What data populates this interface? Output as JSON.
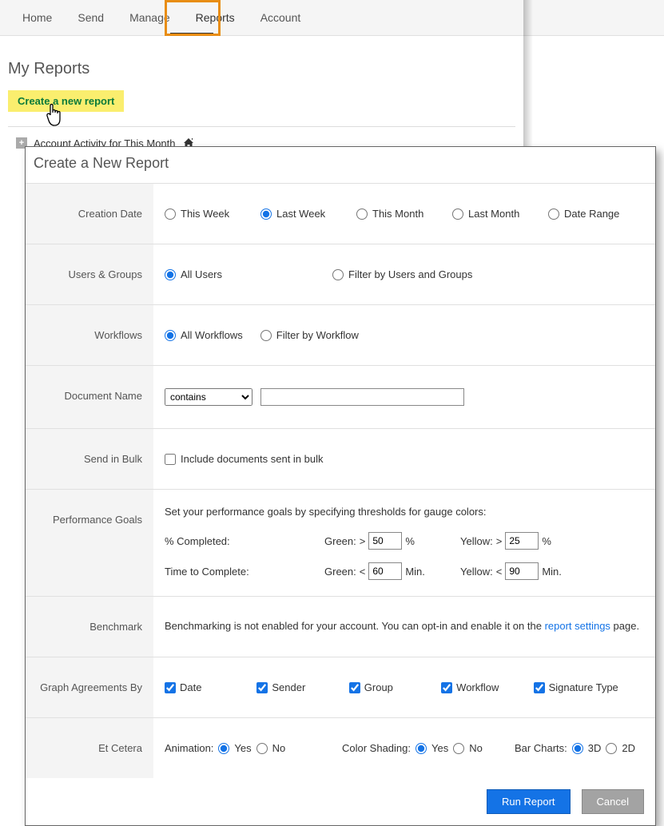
{
  "nav": {
    "home": "Home",
    "send": "Send",
    "manage": "Manage",
    "reports": "Reports",
    "account": "Account"
  },
  "my_reports": {
    "title": "My Reports",
    "create_link": "Create a new report",
    "activity_label": "Account Activity for This Month",
    "plus": "+"
  },
  "modal": {
    "title": "Create a New Report",
    "labels": {
      "creation_date": "Creation Date",
      "users_groups": "Users & Groups",
      "workflows": "Workflows",
      "document_name": "Document Name",
      "send_bulk": "Send in Bulk",
      "perf_goals": "Performance Goals",
      "benchmark": "Benchmark",
      "graph_by": "Graph Agreements By",
      "et_cetera": "Et Cetera"
    },
    "creation_date_options": {
      "this_week": "This Week",
      "last_week": "Last Week",
      "this_month": "This Month",
      "last_month": "Last Month",
      "date_range": "Date Range"
    },
    "users_groups_options": {
      "all": "All Users",
      "filter": "Filter by Users and Groups"
    },
    "workflows_options": {
      "all": "All Workflows",
      "filter": "Filter by Workflow"
    },
    "doc_name": {
      "operator": "contains",
      "value": ""
    },
    "bulk_checkbox": "Include documents sent in bulk",
    "perf": {
      "intro": "Set your performance goals by specifying thresholds for gauge colors:",
      "pct_label": "% Completed:",
      "time_label": "Time to Complete:",
      "green": "Green:",
      "yellow": "Yellow:",
      "gt": ">",
      "lt": "<",
      "pct": "%",
      "min": "Min.",
      "green_pct": "50",
      "yellow_pct": "25",
      "green_time": "60",
      "yellow_time": "90"
    },
    "benchmark_text_1": "Benchmarking is not enabled for your account. You can opt-in and enable it on the ",
    "benchmark_link": "report settings",
    "benchmark_text_2": " page.",
    "graph_by_opts": {
      "date": "Date",
      "sender": "Sender",
      "group": "Group",
      "workflow": "Workflow",
      "signature_type": "Signature Type"
    },
    "etc": {
      "animation": "Animation:",
      "color_shading": "Color Shading:",
      "bar_charts": "Bar Charts:",
      "yes": "Yes",
      "no": "No",
      "three_d": "3D",
      "two_d": "2D"
    },
    "buttons": {
      "run": "Run Report",
      "cancel": "Cancel"
    }
  }
}
